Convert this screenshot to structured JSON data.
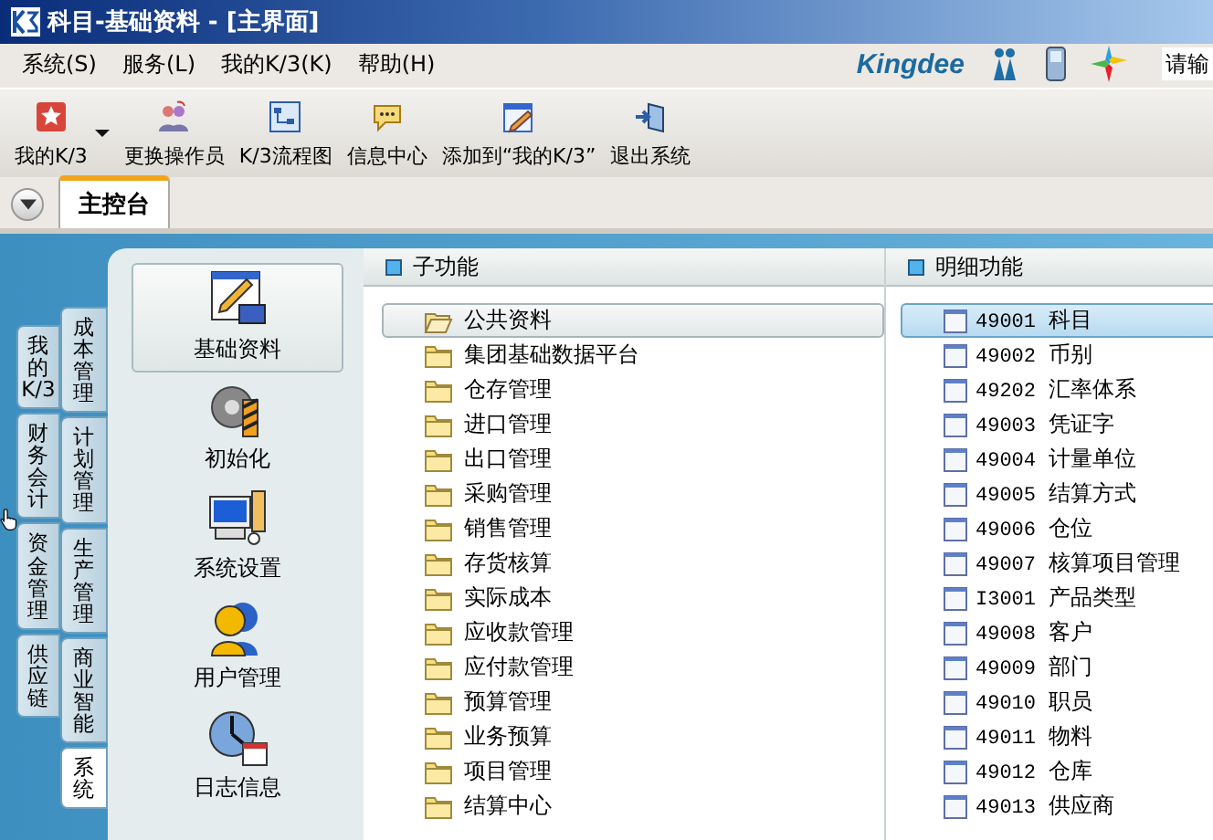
{
  "window": {
    "title": "科目-基础资料 - [主界面]"
  },
  "menu": [
    "系统(S)",
    "服务(L)",
    "我的K/3(K)",
    "帮助(H)"
  ],
  "brand": {
    "logo": "Kingdee",
    "search": {
      "placeholder": "请输"
    }
  },
  "toolbar": [
    {
      "label": "我的K/3",
      "has_menu": true
    },
    {
      "label": "更换操作员",
      "has_menu": false
    },
    {
      "label": "K/3流程图",
      "has_menu": false
    },
    {
      "label": "信息中心",
      "has_menu": false
    },
    {
      "label": "添加到“我的K/3”",
      "has_menu": false
    },
    {
      "label": "退出系统",
      "has_menu": false
    }
  ],
  "tabs": [
    {
      "label": "主控台",
      "selected": true
    }
  ],
  "outer_tabs": [
    {
      "label": "我的K/3",
      "selected": false
    },
    {
      "label": "财务会计",
      "selected": false
    },
    {
      "label": "资金管理",
      "selected": false
    },
    {
      "label": "供应链",
      "selected": false
    }
  ],
  "inner_tabs": [
    {
      "label": "成本管理",
      "selected": false
    },
    {
      "label": "计划管理",
      "selected": false
    },
    {
      "label": "生产管理",
      "selected": false
    },
    {
      "label": "商业智能",
      "selected": false
    },
    {
      "label": "系统",
      "selected": true
    }
  ],
  "modules": [
    {
      "label": "基础资料",
      "selected": true
    },
    {
      "label": "初始化",
      "selected": false
    },
    {
      "label": "系统设置",
      "selected": false
    },
    {
      "label": "用户管理",
      "selected": false
    },
    {
      "label": "日志信息",
      "selected": false
    }
  ],
  "sub_functions": {
    "title": "子功能",
    "items": [
      {
        "label": "公共资料",
        "selected": true
      },
      {
        "label": "集团基础数据平台",
        "selected": false
      },
      {
        "label": "仓存管理",
        "selected": false
      },
      {
        "label": "进口管理",
        "selected": false
      },
      {
        "label": "出口管理",
        "selected": false
      },
      {
        "label": "采购管理",
        "selected": false
      },
      {
        "label": "销售管理",
        "selected": false
      },
      {
        "label": "存货核算",
        "selected": false
      },
      {
        "label": "实际成本",
        "selected": false
      },
      {
        "label": "应收款管理",
        "selected": false
      },
      {
        "label": "应付款管理",
        "selected": false
      },
      {
        "label": "预算管理",
        "selected": false
      },
      {
        "label": "业务预算",
        "selected": false
      },
      {
        "label": "项目管理",
        "selected": false
      },
      {
        "label": "结算中心",
        "selected": false
      }
    ]
  },
  "details": {
    "title": "明细功能",
    "items": [
      {
        "code": "49001",
        "name": "科目",
        "selected": true
      },
      {
        "code": "49002",
        "name": "币别",
        "selected": false
      },
      {
        "code": "49202",
        "name": "汇率体系",
        "selected": false
      },
      {
        "code": "49003",
        "name": "凭证字",
        "selected": false
      },
      {
        "code": "49004",
        "name": "计量单位",
        "selected": false
      },
      {
        "code": "49005",
        "name": "结算方式",
        "selected": false
      },
      {
        "code": "49006",
        "name": "仓位",
        "selected": false
      },
      {
        "code": "49007",
        "name": "核算项目管理",
        "selected": false
      },
      {
        "code": "I3001",
        "name": "产品类型",
        "selected": false
      },
      {
        "code": "49008",
        "name": "客户",
        "selected": false
      },
      {
        "code": "49009",
        "name": "部门",
        "selected": false
      },
      {
        "code": "49010",
        "name": "职员",
        "selected": false
      },
      {
        "code": "49011",
        "name": "物料",
        "selected": false
      },
      {
        "code": "49012",
        "name": "仓库",
        "selected": false
      },
      {
        "code": "49013",
        "name": "供应商",
        "selected": false
      }
    ]
  }
}
